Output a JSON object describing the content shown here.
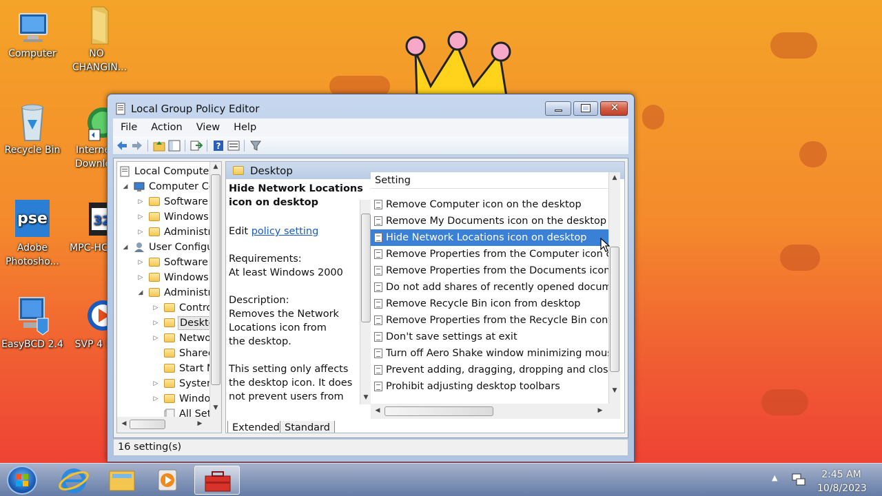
{
  "desktop": {
    "icons": [
      {
        "label": "Computer"
      },
      {
        "label": "NO CHANGIN..."
      },
      {
        "label": "Recycle Bin"
      },
      {
        "label": "Interne Downlo"
      },
      {
        "label": "Adobe Photosho..."
      },
      {
        "label": "MPC-HC"
      },
      {
        "label": "EasyBCD 2.4"
      },
      {
        "label": "SVP 4 F"
      }
    ]
  },
  "window": {
    "title": "Local Group Policy Editor",
    "menu": [
      "File",
      "Action",
      "View",
      "Help"
    ],
    "tree": [
      {
        "label": "Local Computer",
        "arrow": ""
      },
      {
        "label": "Computer Co",
        "arrow": "◢"
      },
      {
        "label": "Software",
        "arrow": "▷"
      },
      {
        "label": "Windows",
        "arrow": "▷"
      },
      {
        "label": "Administr",
        "arrow": "▷"
      },
      {
        "label": "User Configu",
        "arrow": "◢"
      },
      {
        "label": "Software",
        "arrow": "▷"
      },
      {
        "label": "Windows",
        "arrow": "▷"
      },
      {
        "label": "Administr",
        "arrow": "◢"
      },
      {
        "label": "Contro",
        "arrow": "▷"
      },
      {
        "label": "Deskto",
        "arrow": "▷"
      },
      {
        "label": "Netwo",
        "arrow": "▷"
      },
      {
        "label": "Shared",
        "arrow": ""
      },
      {
        "label": "Start M",
        "arrow": ""
      },
      {
        "label": "Systen",
        "arrow": "▷"
      },
      {
        "label": "Windo",
        "arrow": "▷"
      },
      {
        "label": "All Set",
        "arrow": ""
      }
    ],
    "pane_header": "Desktop",
    "description": {
      "title": "Hide Network Locations icon on desktop",
      "edit_prefix": "Edit",
      "edit_link": "policy setting",
      "req_label": "Requirements:",
      "req_value": "At least Windows 2000",
      "desc_label": "Description:",
      "desc_text": "Removes the Network Locations icon from the desktop.",
      "note": "This setting only affects the desktop icon. It does not prevent users from connecting to the network"
    },
    "list_header": "Setting",
    "settings": [
      "Remove Computer icon on the desktop",
      "Remove My Documents icon on the desktop",
      "Hide Network Locations icon on desktop",
      "Remove Properties from the Computer icon con...",
      "Remove Properties from the Documents icon co...",
      "Do not add shares of recently opened documen...",
      "Remove Recycle Bin icon from desktop",
      "Remove Properties from the Recycle Bin contex...",
      "Don't save settings at exit",
      "Turn off Aero Shake window minimizing mouse ...",
      "Prevent adding, dragging, dropping and closing...",
      "Prohibit adjusting desktop toolbars"
    ],
    "selected_setting": "Hide Network Locations icon on desktop",
    "tabs": [
      "Extended",
      "Standard"
    ],
    "status": "16 setting(s)"
  },
  "taskbar": {
    "time": "2:45 AM",
    "date": "10/8/2023"
  }
}
